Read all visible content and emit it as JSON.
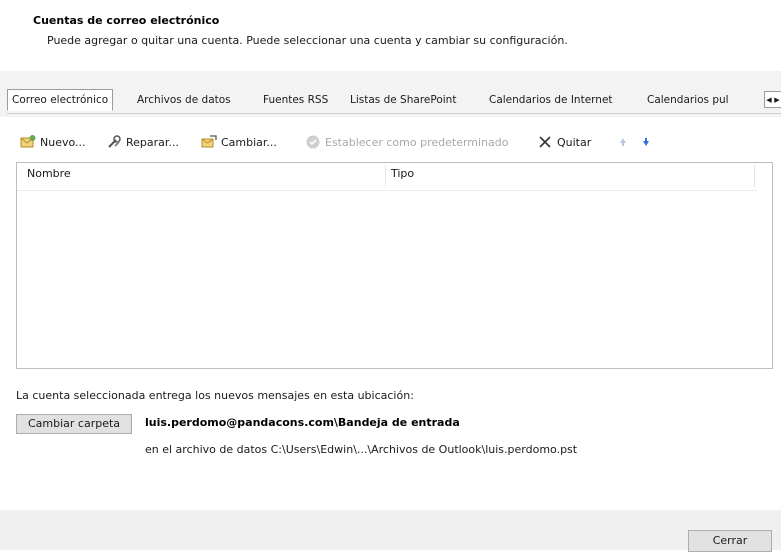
{
  "header": {
    "title": "Cuentas de correo electrónico",
    "subtitle": "Puede agregar o quitar una cuenta. Puede seleccionar una cuenta y cambiar su configuración."
  },
  "tabs": [
    {
      "label": "Correo electrónico",
      "selected": true
    },
    {
      "label": "Archivos de datos",
      "selected": false
    },
    {
      "label": "Fuentes RSS",
      "selected": false
    },
    {
      "label": "Listas de SharePoint",
      "selected": false
    },
    {
      "label": "Calendarios de Internet",
      "selected": false
    },
    {
      "label": "Calendarios pul",
      "selected": false
    }
  ],
  "toolbar": {
    "new_label": "Nuevo...",
    "repair_label": "Reparar...",
    "change_label": "Cambiar...",
    "set_default_label": "Establecer como predeterminado",
    "remove_label": "Quitar"
  },
  "list": {
    "columns": [
      "Nombre",
      "Tipo"
    ],
    "rows": []
  },
  "delivery": {
    "note": "La cuenta seleccionada entrega los nuevos mensajes en esta ubicación:",
    "change_folder_label": "Cambiar carpeta",
    "mailbox_path": "luis.perdomo@pandacons.com\\Bandeja de entrada",
    "data_file_path": "en el archivo de datos C:\\Users\\Edwin\\...\\Archivos de Outlook\\luis.perdomo.pst"
  },
  "footer": {
    "close_label": "Cerrar"
  },
  "colors": {
    "tab_band": "#f3f3f3",
    "footer": "#f0f0f0",
    "button_face": "#e1e1e1",
    "arrow_blue": "#2f6fd6",
    "disabled_text": "#a8a8a8"
  }
}
